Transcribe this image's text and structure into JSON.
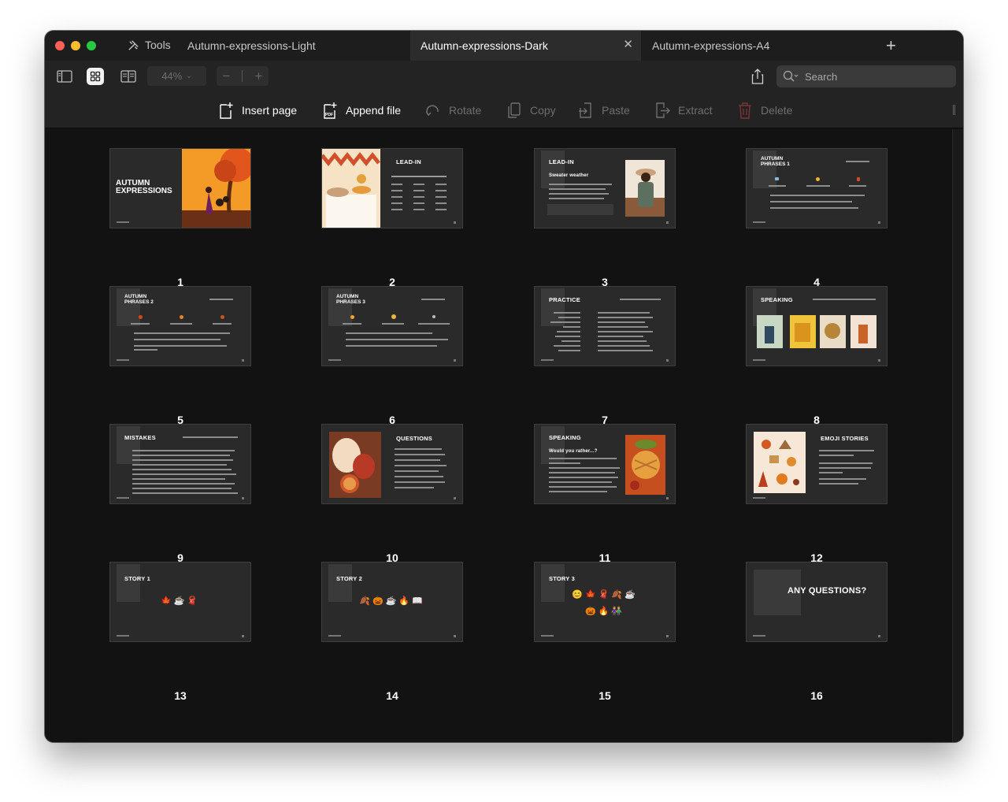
{
  "window": {
    "tools_label": "Tools",
    "tabs": [
      {
        "label": "Autumn-expressions-Light"
      },
      {
        "label": "Autumn-expressions-Dark"
      },
      {
        "label": "Autumn-expressions-A4"
      }
    ],
    "active_tab": 1
  },
  "toolbar": {
    "zoom": "44%",
    "search_placeholder": "Search"
  },
  "actions": [
    {
      "label": "Insert page",
      "enabled": true,
      "icon": "insert-page-icon"
    },
    {
      "label": "Append file",
      "enabled": true,
      "icon": "append-pdf-icon"
    },
    {
      "label": "Rotate",
      "enabled": false,
      "icon": "rotate-icon"
    },
    {
      "label": "Copy",
      "enabled": false,
      "icon": "copy-icon"
    },
    {
      "label": "Paste",
      "enabled": false,
      "icon": "paste-icon"
    },
    {
      "label": "Extract",
      "enabled": false,
      "icon": "extract-icon"
    },
    {
      "label": "Delete",
      "enabled": false,
      "icon": "trash-icon"
    }
  ],
  "pages": [
    {
      "num": "1",
      "title": "AUTUMN\nEXPRESSIONS"
    },
    {
      "num": "2",
      "title": "LEAD-IN"
    },
    {
      "num": "3",
      "title": "LEAD-IN",
      "subtitle": "Sweater weather"
    },
    {
      "num": "4",
      "title": "AUTUMN\nPHRASES 1"
    },
    {
      "num": "5",
      "title": "AUTUMN\nPHRASES 2"
    },
    {
      "num": "6",
      "title": "AUTUMN\nPHRASES 3"
    },
    {
      "num": "7",
      "title": "PRACTICE"
    },
    {
      "num": "8",
      "title": "SPEAKING"
    },
    {
      "num": "9",
      "title": "MISTAKES"
    },
    {
      "num": "10",
      "title": "QUESTIONS"
    },
    {
      "num": "11",
      "title": "SPEAKING",
      "subtitle": "Would you rather...?"
    },
    {
      "num": "12",
      "title": "EMOJI STORIES"
    },
    {
      "num": "13",
      "title": "STORY 1",
      "emoji": "🍁☕🧣"
    },
    {
      "num": "14",
      "title": "STORY 2",
      "emoji": "🍂🎃☕🔥📖"
    },
    {
      "num": "15",
      "title": "STORY 3",
      "emoji": "😊🍁🧣🍂☕",
      "emoji2": "🎃🔥👫"
    },
    {
      "num": "16",
      "title": "ANY QUESTIONS?"
    }
  ],
  "colors": {
    "accent_orange": "#e07a1f",
    "window_bg": "#121212",
    "slide_bg": "#2a2a2a"
  }
}
